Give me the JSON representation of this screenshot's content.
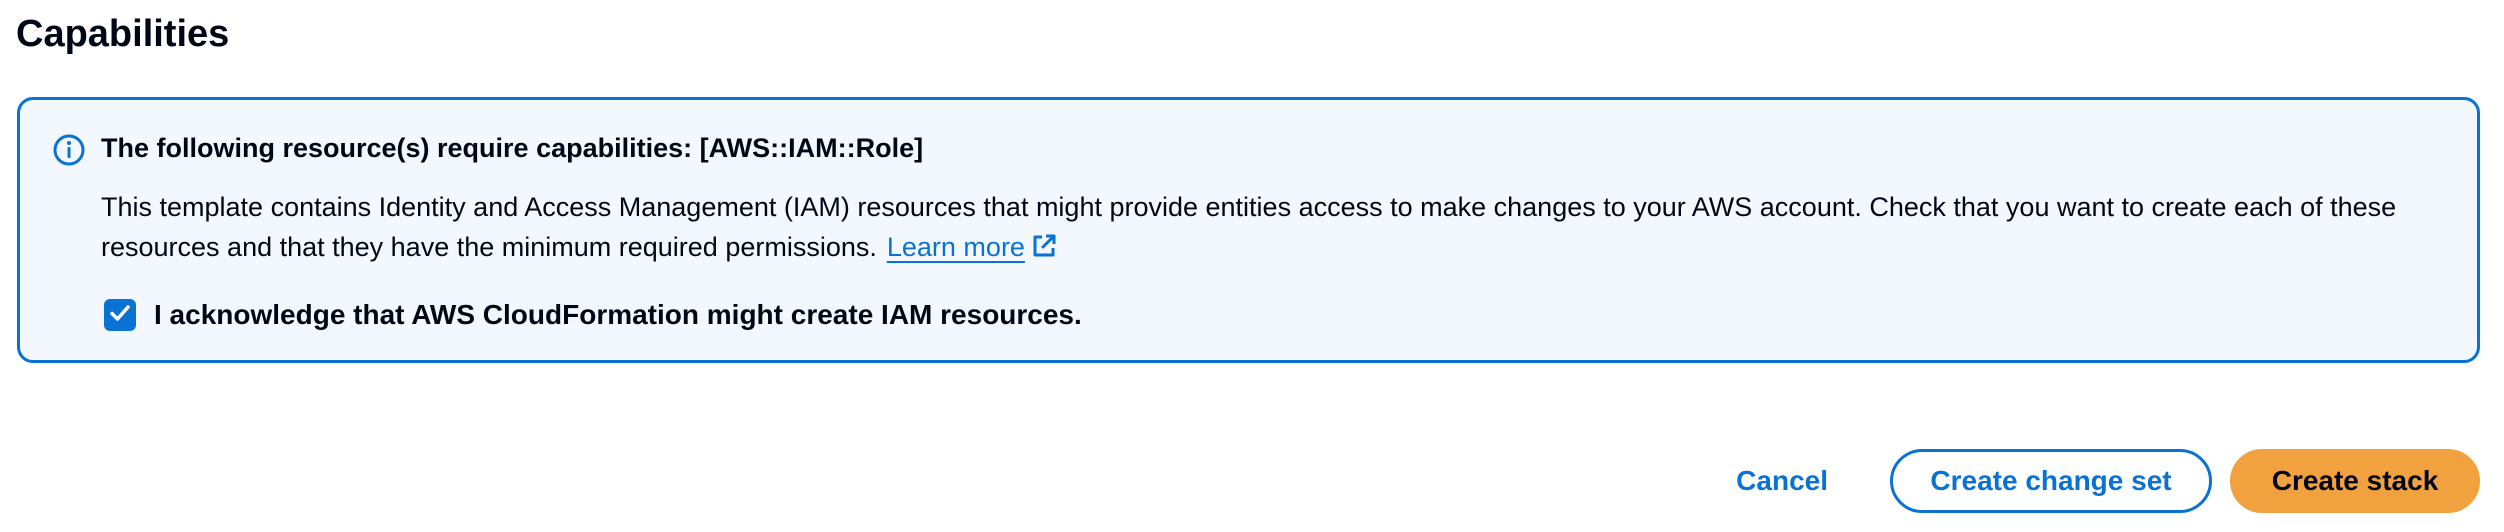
{
  "section": {
    "title": "Capabilities"
  },
  "alert": {
    "type": "info",
    "header": "The following resource(s) require capabilities: [AWS::IAM::Role]",
    "body": "This template contains Identity and Access Management (IAM) resources that might provide entities access to make changes to your AWS account. Check that you want to create each of these resources and that they have the minimum required permissions.",
    "learn_more": "Learn more",
    "acknowledge": {
      "label": "I acknowledge that AWS CloudFormation might create IAM resources.",
      "checked": true
    }
  },
  "actions": {
    "cancel": "Cancel",
    "create_change_set": "Create change set",
    "create_stack": "Create stack"
  },
  "colors": {
    "accent": "#0972d3",
    "alert_background": "#f2f8fd",
    "primary_button": "#f1a13e",
    "text": "#000716"
  },
  "icons": {
    "info": "info-icon",
    "external_link": "external-link-icon",
    "check": "check-icon"
  }
}
